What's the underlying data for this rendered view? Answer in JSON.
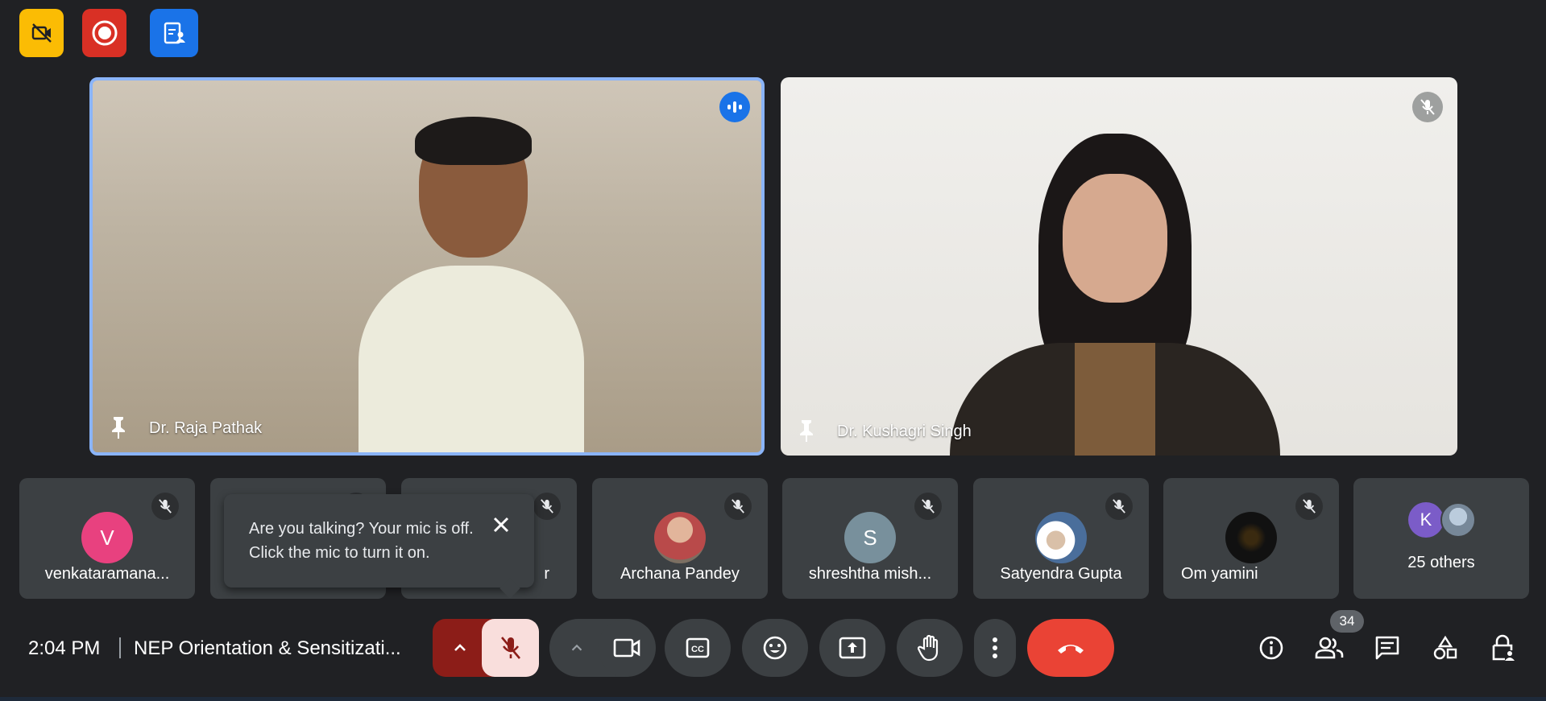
{
  "top_buttons": [
    {
      "icon": "video-off-icon",
      "color": "#fbbc04"
    },
    {
      "icon": "record-icon",
      "color": "#d93025"
    },
    {
      "icon": "clipboard-person-icon",
      "color": "#1a73e8"
    }
  ],
  "main_tiles": [
    {
      "name": "Dr. Raja Pathak",
      "state": "speaking"
    },
    {
      "name": "Dr. Kushagri Singh",
      "state": "muted"
    }
  ],
  "participants": [
    {
      "name": "venkataramana...",
      "avatar_letter": "V",
      "avatar_color": "#e8417f"
    },
    {
      "name": "",
      "avatar_letter": "",
      "avatar_color": "#3c4043"
    },
    {
      "name": "r",
      "avatar_letter": "",
      "avatar_color": "#3c4043"
    },
    {
      "name": "Archana Pandey",
      "avatar_letter": "",
      "avatar_color": "#c2685b"
    },
    {
      "name": "shreshtha mish...",
      "avatar_letter": "S",
      "avatar_color": "#78909c"
    },
    {
      "name": "Satyendra Gupta",
      "avatar_letter": "",
      "avatar_color": "#9aa8b6"
    },
    {
      "name": "Om yamini",
      "avatar_letter": "",
      "avatar_color": "#111111"
    }
  ],
  "others_tile": {
    "label": "25 others",
    "avatar_letter": "K",
    "avatar_color": "#7b5cc8"
  },
  "tooltip": {
    "text": "Are you talking? Your mic is off. Click the mic to turn it on."
  },
  "meeting": {
    "time": "2:04 PM",
    "title": "NEP Orientation & Sensitizati..."
  },
  "people_count": "34",
  "colors": {
    "accent": "#8ab4f8",
    "end_call": "#ea4335",
    "mic_off_bg": "#f9dedc",
    "background": "#202124"
  }
}
